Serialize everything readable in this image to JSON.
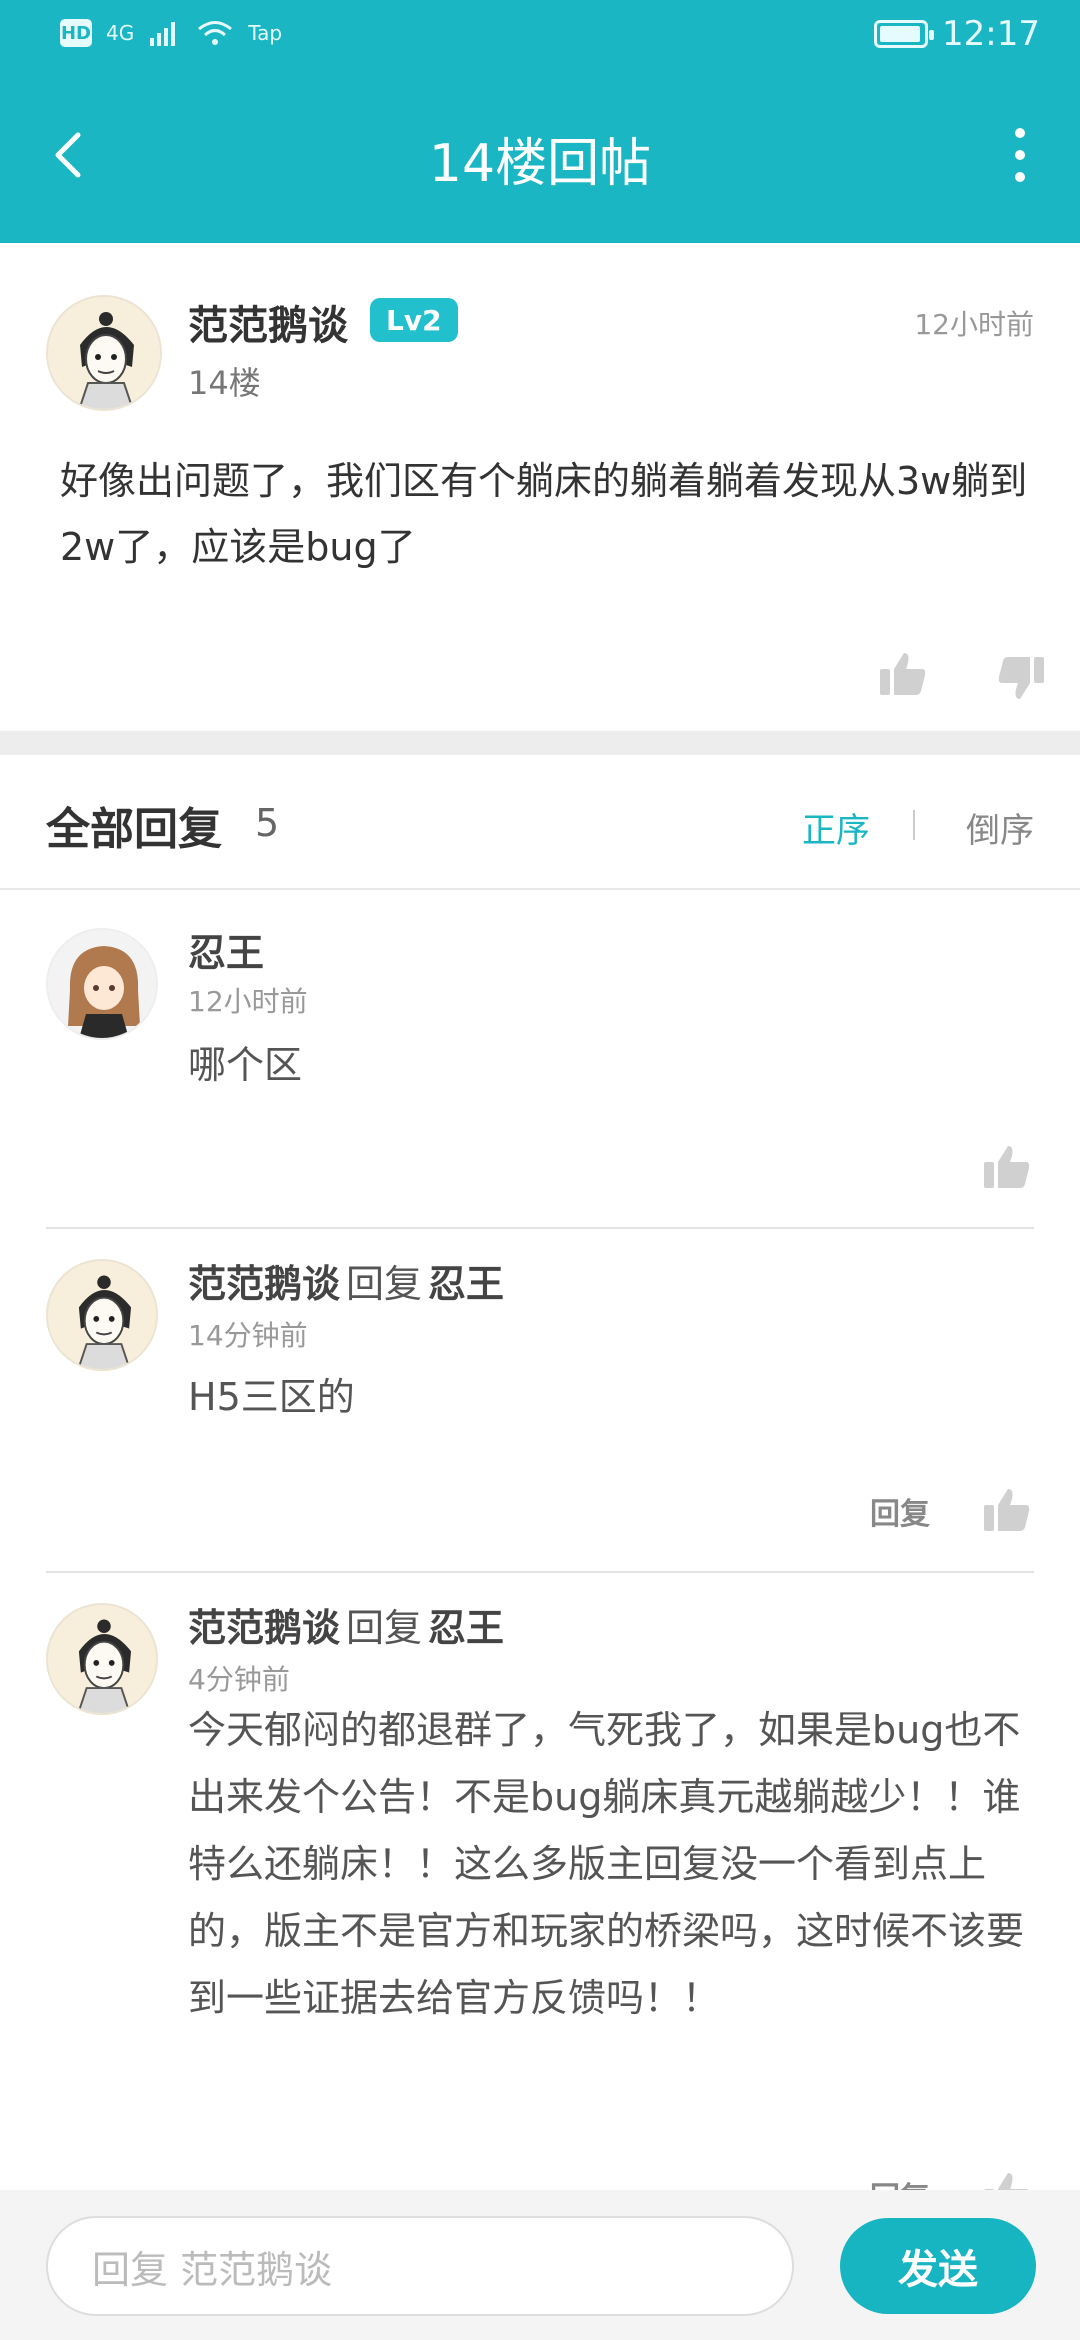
{
  "status_bar": {
    "time": "12:17",
    "network": "4G",
    "hd": "HD",
    "extra": "Tap"
  },
  "header": {
    "title": "14楼回帖"
  },
  "post": {
    "author": "范范鹅谈",
    "level": "Lv2",
    "floor": "14楼",
    "time": "12小时前",
    "content": "好像出问题了，我们区有个躺床的躺着躺着发现从3w躺到2w了，应该是bug了"
  },
  "replies_section": {
    "title": "全部回复",
    "count": "5",
    "sort_asc": "正序",
    "sort_desc": "倒序"
  },
  "replies": [
    {
      "author": "忍王",
      "time": "12小时前",
      "text": "哪个区"
    },
    {
      "author": "范范鹅谈",
      "reply_word": "回复",
      "target": "忍王",
      "time": "14分钟前",
      "text": "H5三区的",
      "reply_label": "回复"
    },
    {
      "author": "范范鹅谈",
      "reply_word": "回复",
      "target": "忍王",
      "time": "4分钟前",
      "text": "今天郁闷的都退群了，气死我了，如果是bug也不出来发个公告！不是bug躺床真元越躺越少！！谁特么还躺床！！这么多版主回复没一个看到点上的，版主不是官方和玩家的桥梁吗，这时候不该要到一些证据去给官方反馈吗！！",
      "reply_label": "回复"
    }
  ],
  "composer": {
    "placeholder": "回复 范范鹅谈",
    "send_label": "发送"
  },
  "colors": {
    "brand": "#1ab6c4",
    "level_badge": "#22bfcc"
  }
}
